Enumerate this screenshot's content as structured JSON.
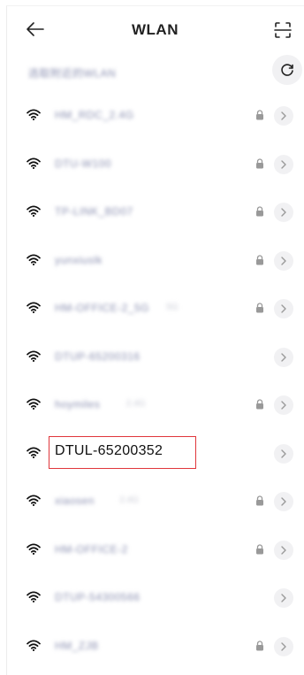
{
  "header": {
    "title": "WLAN"
  },
  "subheader": {
    "hint": "选取附近的WLAN"
  },
  "networks": [
    {
      "ssid": "HM_RDC_2.4G",
      "locked": true,
      "extra": ""
    },
    {
      "ssid": "DTU-W100",
      "locked": true,
      "extra": ""
    },
    {
      "ssid": "TP-LINK_BD07",
      "locked": true,
      "extra": ""
    },
    {
      "ssid": "yunxiuslk",
      "locked": true,
      "extra": ""
    },
    {
      "ssid": "HM-OFFICE-2_5G",
      "locked": true,
      "extra": "5G"
    },
    {
      "ssid": "DTUP-65200316",
      "locked": false,
      "extra": ""
    },
    {
      "ssid": "hoymiles",
      "locked": true,
      "extra": "2.4G"
    },
    {
      "ssid": "DTUL-65200352",
      "locked": false,
      "extra": "",
      "highlighted": true
    },
    {
      "ssid": "xiaosen",
      "locked": true,
      "extra": "2.4G"
    },
    {
      "ssid": "HM-OFFICE-2",
      "locked": true,
      "extra": ""
    },
    {
      "ssid": "DTUP-54300566",
      "locked": false,
      "extra": ""
    },
    {
      "ssid": "HM_ZJB",
      "locked": true,
      "extra": ""
    }
  ],
  "colors": {
    "highlight_border": "#e0363b",
    "blur_text": "#8a8fb0",
    "chip_bg": "#f1f1f3"
  }
}
